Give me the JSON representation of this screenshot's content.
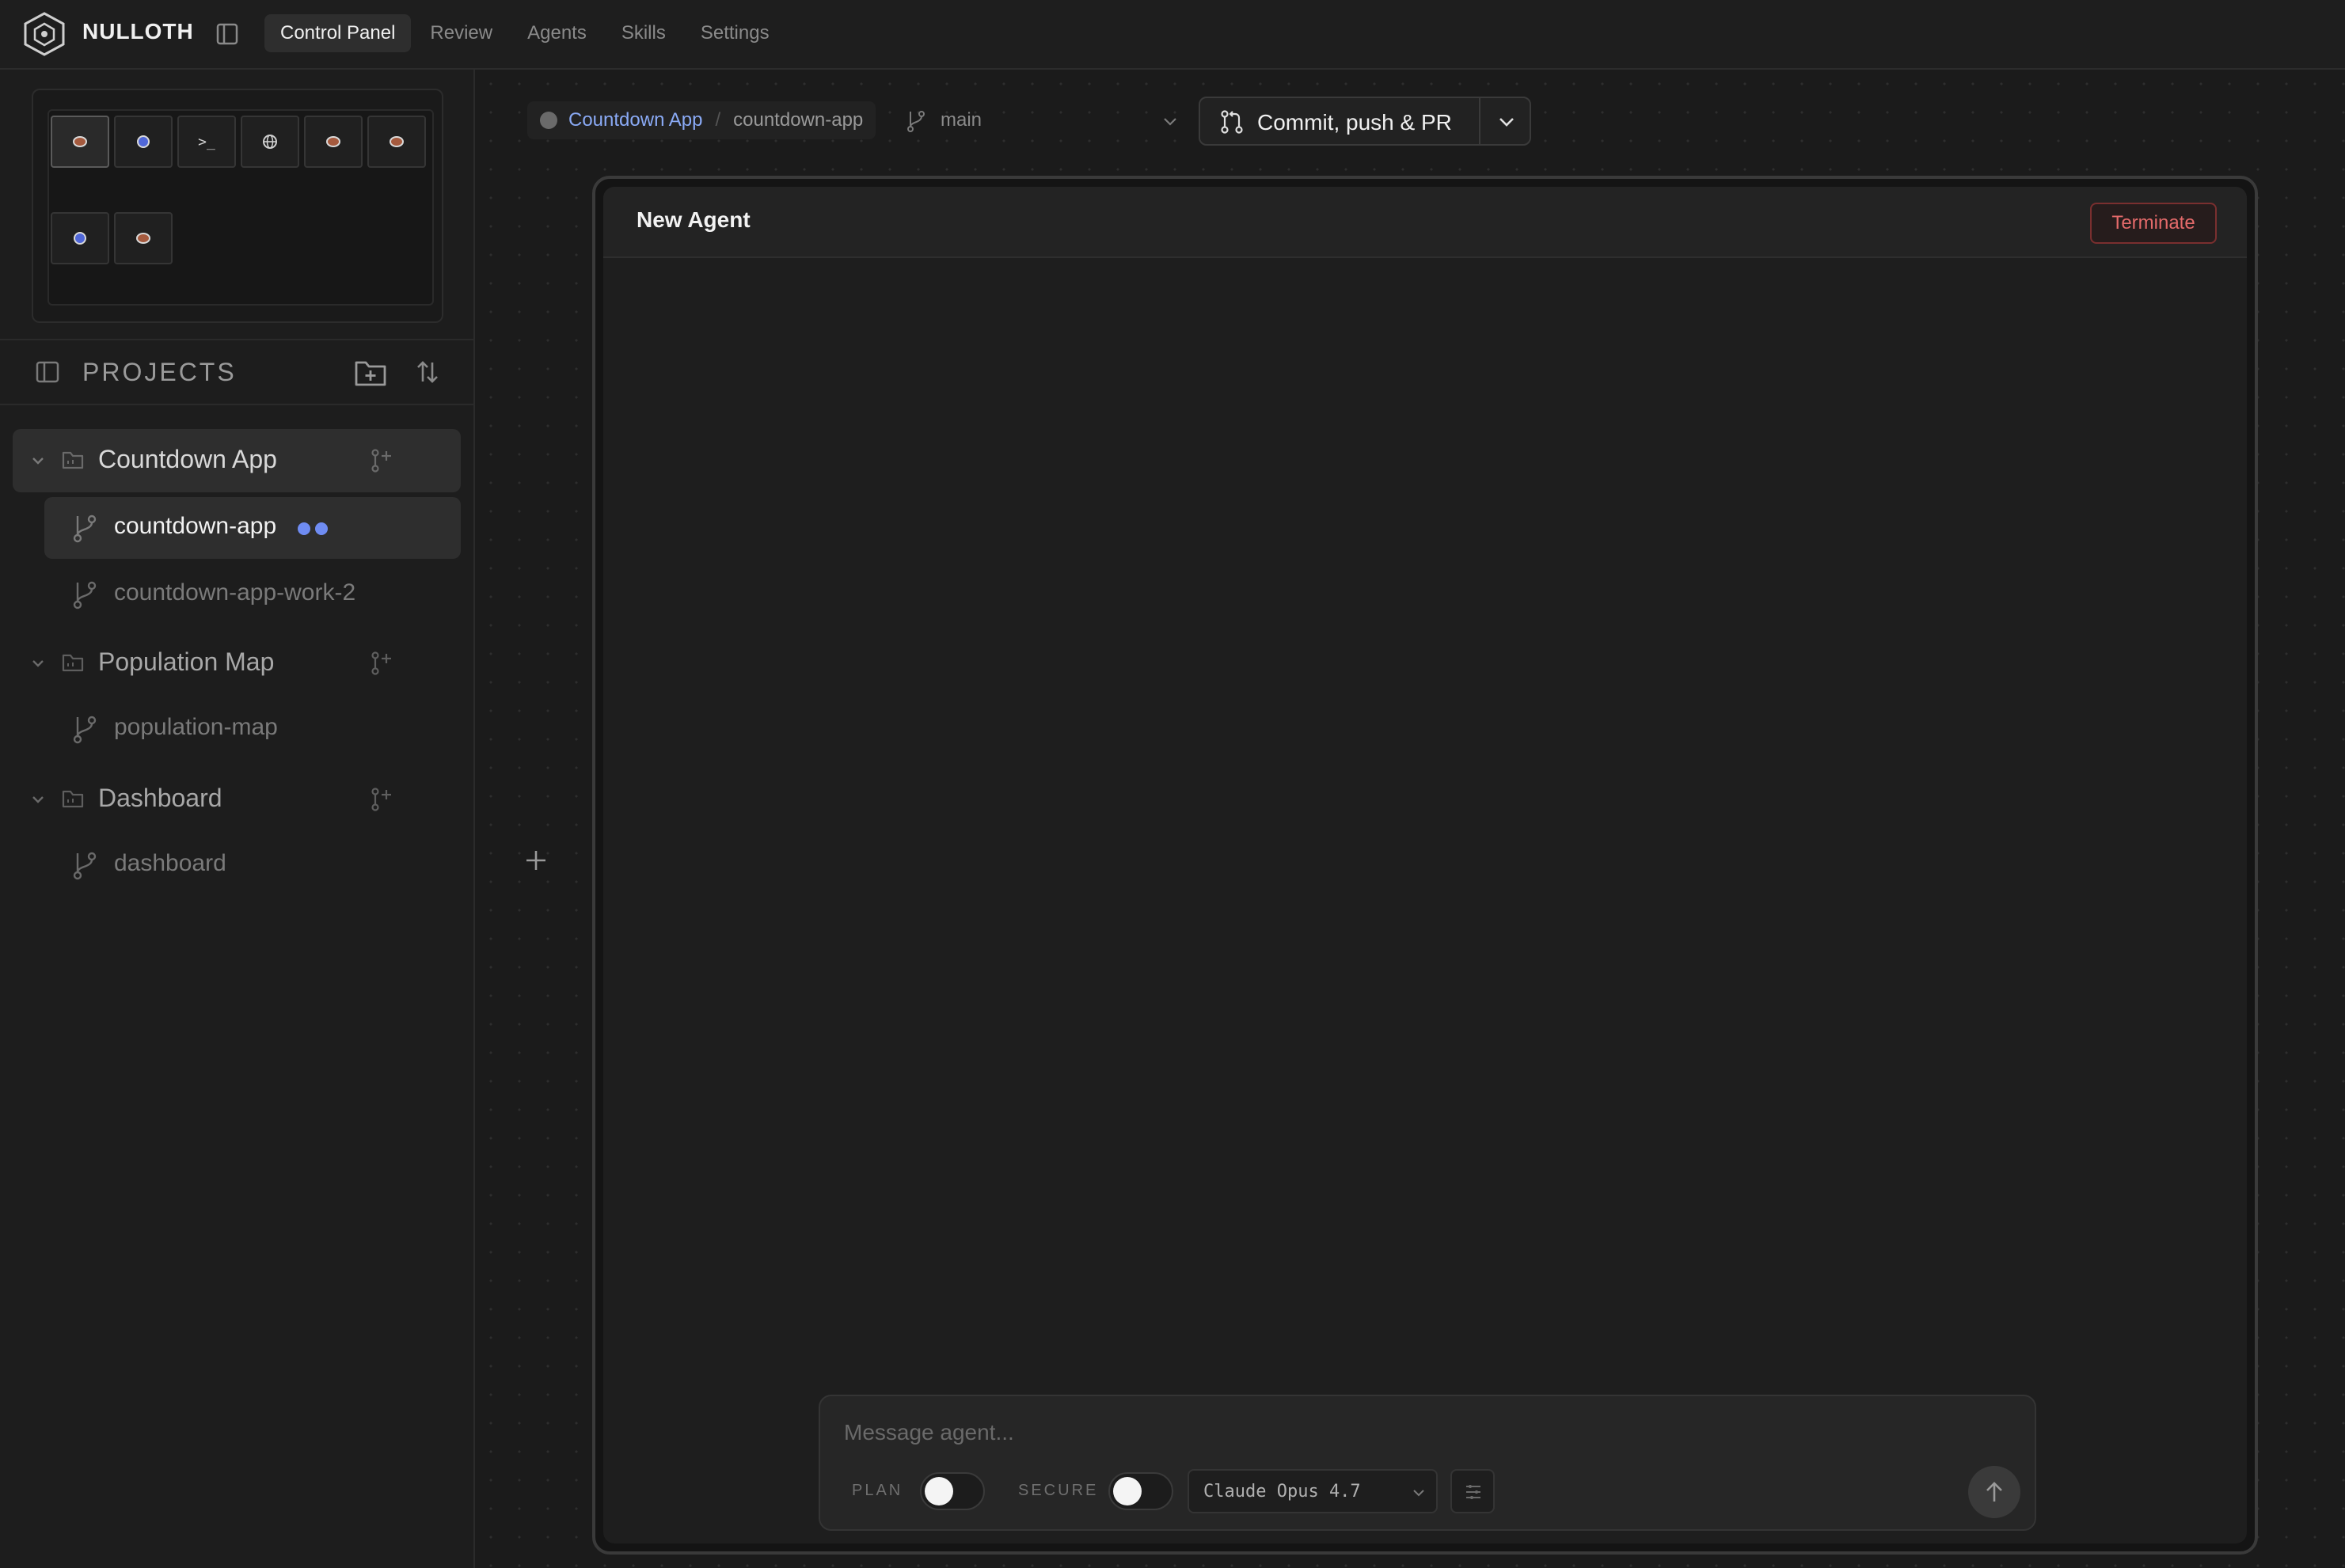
{
  "app": {
    "brand": "NULLOTH",
    "nav": [
      {
        "label": "Control Panel",
        "active": true
      },
      {
        "label": "Review",
        "active": false
      },
      {
        "label": "Agents",
        "active": false
      },
      {
        "label": "Skills",
        "active": false
      },
      {
        "label": "Settings",
        "active": false
      }
    ]
  },
  "sidebar": {
    "projects_title": "PROJECTS",
    "projects": [
      {
        "name": "Countdown App",
        "expanded": true,
        "active": true,
        "workspaces": [
          {
            "name": "countdown-app",
            "active": true,
            "status_dots": 2
          },
          {
            "name": "countdown-app-work-2",
            "active": false
          }
        ]
      },
      {
        "name": "Population Map",
        "expanded": true,
        "active": false,
        "workspaces": [
          {
            "name": "population-map",
            "active": false
          }
        ]
      },
      {
        "name": "Dashboard",
        "expanded": true,
        "active": false,
        "workspaces": [
          {
            "name": "dashboard",
            "active": false
          }
        ]
      }
    ]
  },
  "toolbar": {
    "breadcrumb_project": "Countdown App",
    "breadcrumb_separator": "/",
    "breadcrumb_workspace": "countdown-app",
    "branch": "main",
    "commit_label": "Commit, push & PR"
  },
  "agent": {
    "title": "New Agent",
    "terminate_label": "Terminate",
    "composer": {
      "placeholder": "Message agent...",
      "plan_label": "PLAN",
      "secure_label": "SECURE",
      "plan_on": false,
      "secure_on": false,
      "model": "Claude Opus 4.7"
    }
  },
  "colors": {
    "accent_link": "#8aaaf5",
    "status_dot": "#6f8cf2",
    "danger": "#e46a6a"
  }
}
